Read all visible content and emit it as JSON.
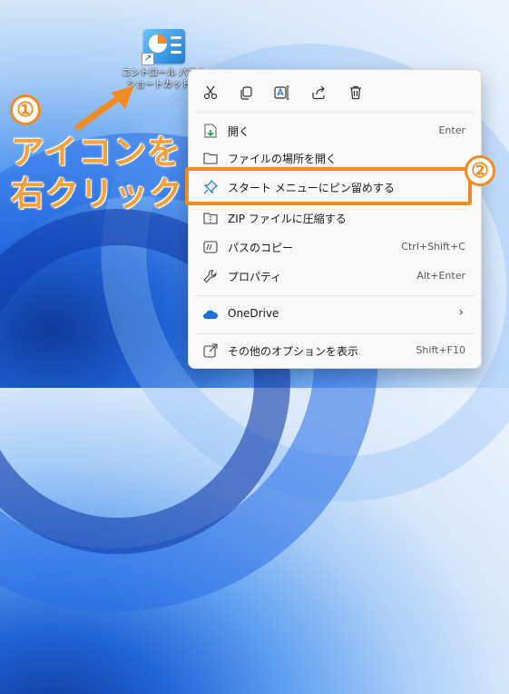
{
  "desktop_icon": {
    "label_line1": "コントロール パネル",
    "label_line2": "ショートカット"
  },
  "annotations": {
    "step1": "①",
    "step2": "②",
    "text_line1": "アイコンを",
    "text_line2": "右クリック",
    "accent_color": "#f28b22"
  },
  "toolbar": {
    "icons": [
      "cut-icon",
      "copy-icon",
      "rename-icon",
      "share-icon",
      "delete-icon"
    ]
  },
  "menu": {
    "items": [
      {
        "label": "開く",
        "shortcut": "Enter",
        "icon": "open-icon"
      },
      {
        "label": "ファイルの場所を開く",
        "shortcut": "",
        "icon": "folder-icon"
      },
      {
        "label": "スタート メニューにピン留めする",
        "shortcut": "",
        "icon": "pin-icon"
      },
      {
        "label": "ZIP ファイルに圧縮する",
        "shortcut": "",
        "icon": "zip-icon"
      },
      {
        "label": "パスのコピー",
        "shortcut": "Ctrl+Shift+C",
        "icon": "path-copy-icon"
      },
      {
        "label": "プロパティ",
        "shortcut": "Alt+Enter",
        "icon": "wrench-icon"
      },
      {
        "label": "OneDrive",
        "shortcut": "",
        "icon": "onedrive-icon"
      },
      {
        "label": "その他のオプションを表示",
        "shortcut": "Shift+F10",
        "icon": "more-options-icon"
      }
    ]
  }
}
